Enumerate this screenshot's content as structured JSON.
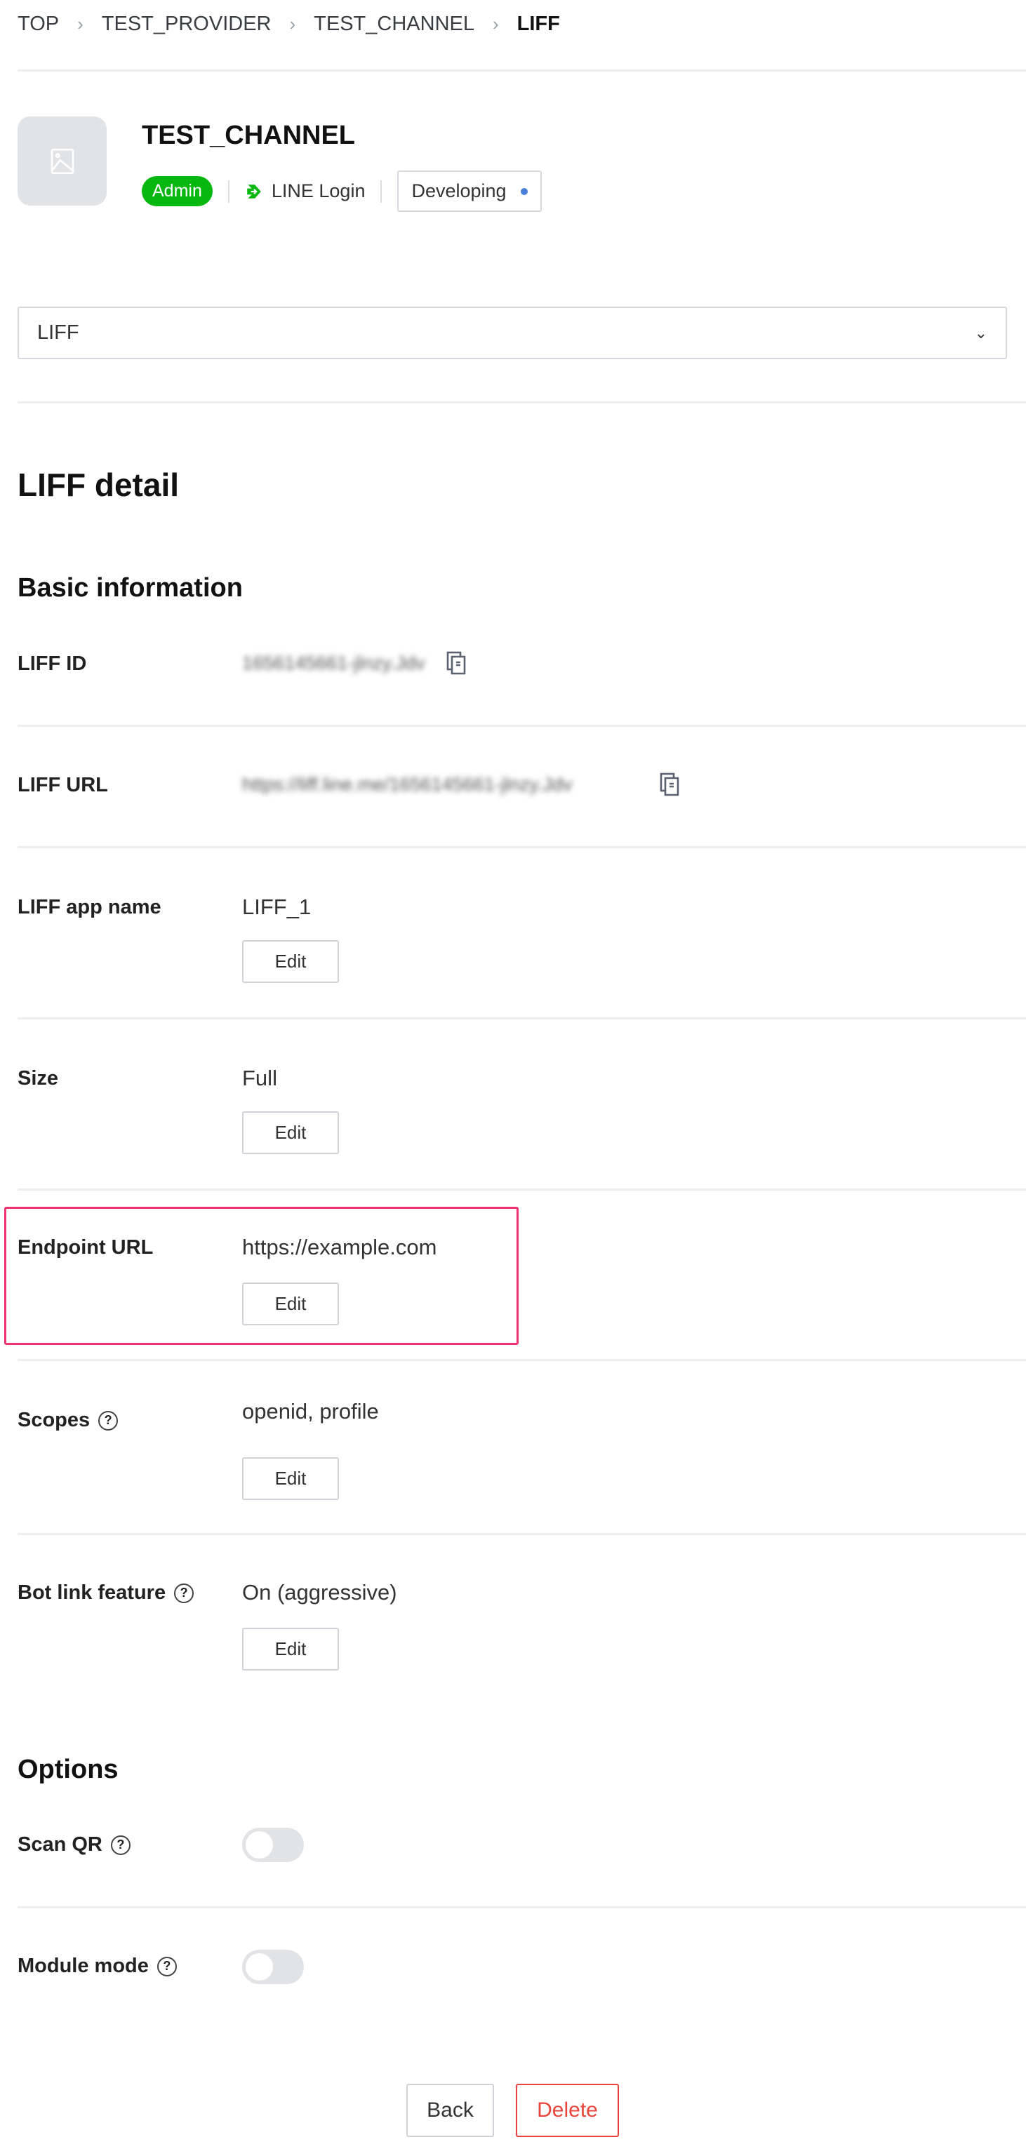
{
  "breadcrumb": [
    "TOP",
    "TEST_PROVIDER",
    "TEST_CHANNEL",
    "LIFF"
  ],
  "channel": {
    "name": "TEST_CHANNEL",
    "role": "Admin",
    "type": "LINE Login",
    "status": "Developing"
  },
  "select": {
    "value": "LIFF"
  },
  "page_title": "LIFF detail",
  "basic": {
    "title": "Basic information",
    "liff_id": {
      "label": "LIFF ID",
      "value": "1656145661-jlnzy.Jdv"
    },
    "liff_url": {
      "label": "LIFF URL",
      "value": "https://liff.line.me/1656145661-jlnzy.Jdv"
    },
    "app_name": {
      "label": "LIFF app name",
      "value": "LIFF_1"
    },
    "size": {
      "label": "Size",
      "value": "Full"
    },
    "endpoint": {
      "label": "Endpoint URL",
      "value": "https://example.com"
    },
    "scopes": {
      "label": "Scopes",
      "value": "openid, profile"
    },
    "bot_link": {
      "label": "Bot link feature",
      "value": "On (aggressive)"
    },
    "edit_label": "Edit"
  },
  "options": {
    "title": "Options",
    "scan_qr": {
      "label": "Scan QR",
      "on": false
    },
    "module_mode": {
      "label": "Module mode",
      "on": false
    }
  },
  "actions": {
    "back": "Back",
    "delete": "Delete"
  },
  "help": "?",
  "colors": {
    "accent": "#06b710",
    "highlight": "#f0336e",
    "danger": "#e8453c"
  }
}
